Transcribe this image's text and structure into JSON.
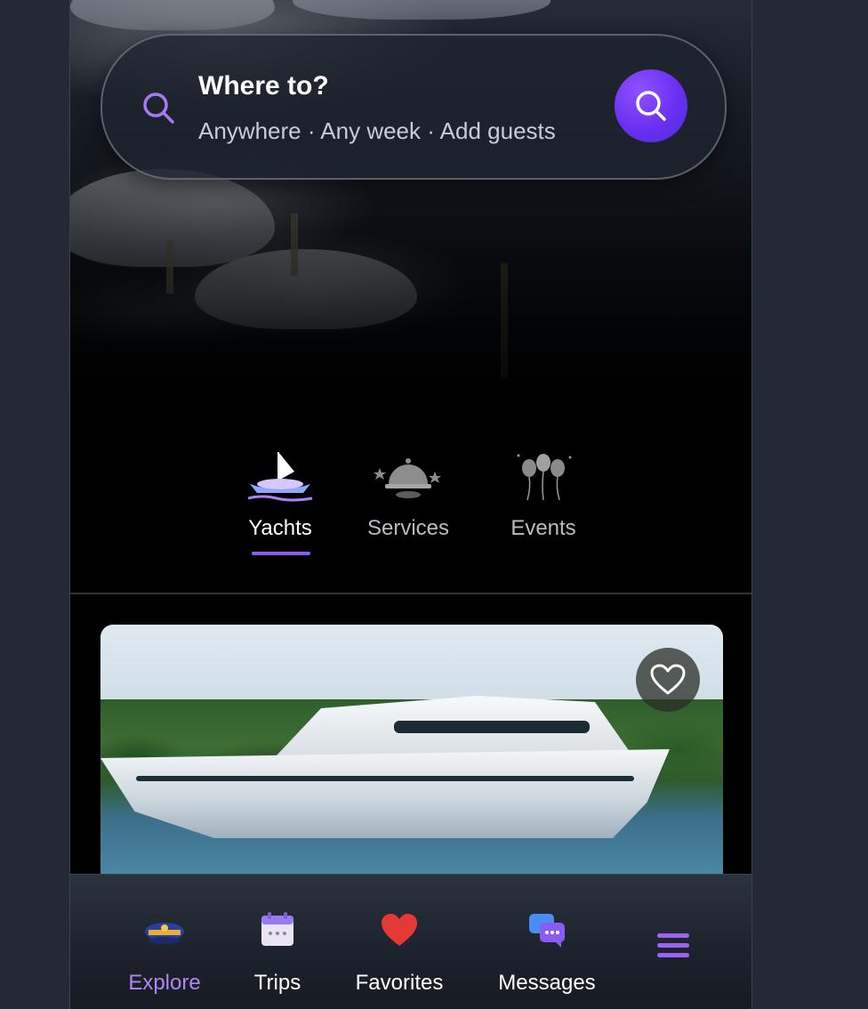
{
  "search": {
    "title": "Where to?",
    "subtitle": "Anywhere · Any week · Add guests",
    "icon": "search-icon",
    "button_icon": "search-icon"
  },
  "categories": [
    {
      "label": "Yachts",
      "icon": "sailboat-icon",
      "active": true
    },
    {
      "label": "Services",
      "icon": "service-bell-icon",
      "active": false
    },
    {
      "label": "Events",
      "icon": "balloons-icon",
      "active": false
    }
  ],
  "listing": {
    "favorite_icon": "heart-outline-icon"
  },
  "tabbar": [
    {
      "label": "Explore",
      "icon": "captain-hat-icon",
      "active": true
    },
    {
      "label": "Trips",
      "icon": "calendar-icon",
      "active": false
    },
    {
      "label": "Favorites",
      "icon": "heart-icon",
      "active": false
    },
    {
      "label": "Messages",
      "icon": "chat-bubbles-icon",
      "active": false
    }
  ],
  "menu": {
    "icon": "hamburger-menu-icon"
  },
  "colors": {
    "accent": "#7b3ff4",
    "active_tab": "#b086f3",
    "underline": "#8c5cf0",
    "favorites_heart": "#e53935",
    "background": "#000000"
  }
}
